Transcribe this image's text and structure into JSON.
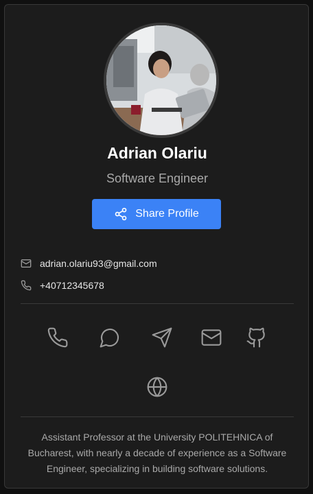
{
  "profile": {
    "name": "Adrian Olariu",
    "title": "Software Engineer",
    "share_label": "Share Profile",
    "avatar_alt": "Profile photo of a person working on a laptop"
  },
  "contacts": {
    "email": "adrian.olariu93@gmail.com",
    "phone": "+40712345678"
  },
  "social_icons": [
    "phone-icon",
    "chat-icon",
    "send-icon",
    "mail-icon",
    "github-icon",
    "globe-icon"
  ],
  "bio": "Assistant Professor at the University POLITEHNICA of Bucharest, with nearly a decade of experience as a Software Engineer, specializing in building software solutions.",
  "colors": {
    "background": "#1c1c1c",
    "accent": "#3b82f6",
    "text_primary": "#ffffff",
    "text_secondary": "#a9a9a9",
    "icon": "#9a9a9a"
  }
}
